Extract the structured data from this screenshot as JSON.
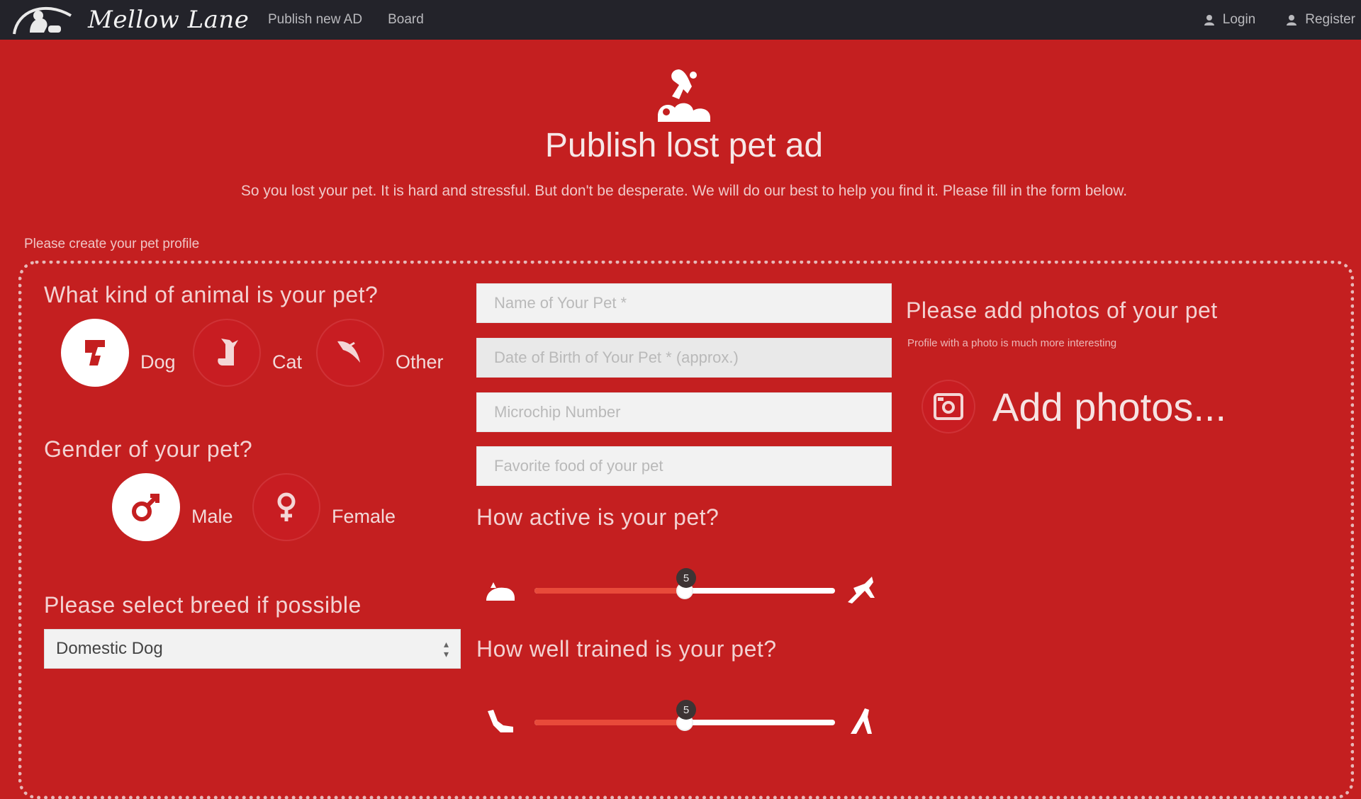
{
  "navbar": {
    "logo_text": "Mellow Lane",
    "links": [
      "Publish new AD",
      "Board"
    ],
    "login_label": "Login",
    "register_label": "Register"
  },
  "header": {
    "title": "Publish lost pet ad",
    "intro": "So you lost your pet. It is hard and stressful. But don't be desperate. We will do our best to help you find it. Please fill in the form below.",
    "profile_caption": "Please create your pet profile"
  },
  "animal": {
    "question": "What kind of animal is your pet?",
    "options": [
      {
        "label": "Dog",
        "icon": "dog-icon",
        "selected": true
      },
      {
        "label": "Cat",
        "icon": "cat-icon",
        "selected": false
      },
      {
        "label": "Other",
        "icon": "bird-icon",
        "selected": false
      }
    ]
  },
  "gender": {
    "question": "Gender of your pet?",
    "options": [
      {
        "label": "Male",
        "icon": "male-icon",
        "selected": true
      },
      {
        "label": "Female",
        "icon": "female-icon",
        "selected": false
      }
    ]
  },
  "breed": {
    "question": "Please select breed if possible",
    "selected": "Domestic Dog"
  },
  "fields": {
    "name_placeholder": "Name of Your Pet *",
    "dob_placeholder": "Date of Birth of Your Pet * (approx.)",
    "microchip_placeholder": "Microchip Number",
    "food_placeholder": "Favorite food of your pet"
  },
  "activity": {
    "question": "How active is your pet?",
    "value": 5,
    "min": 0,
    "max": 10,
    "left_icon": "sleeping-pet-icon",
    "right_icon": "running-pet-icon"
  },
  "training": {
    "question": "How well trained is your pet?",
    "value": 5,
    "min": 0,
    "max": 10,
    "left_icon": "untrained-pet-icon",
    "right_icon": "trained-pet-icon"
  },
  "photos": {
    "title": "Please add photos of your pet",
    "subtitle": "Profile with a photo is much more interesting",
    "add_label": "Add photos..."
  },
  "colors": {
    "background": "#c41f20",
    "navbar": "#23232a",
    "slider_fill": "#e84a3a"
  }
}
